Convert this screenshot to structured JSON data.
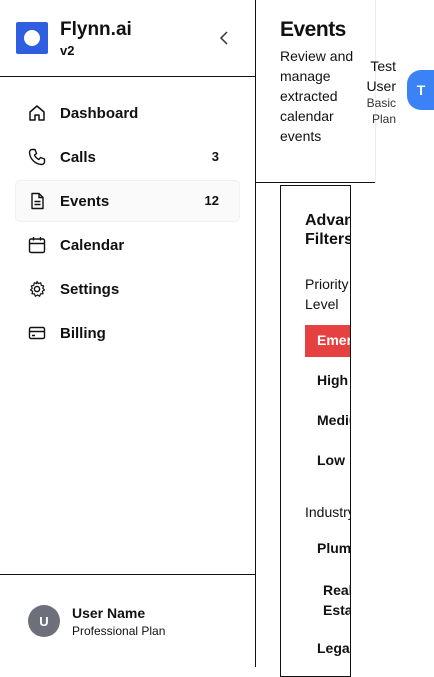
{
  "brand": {
    "name": "Flynn.ai",
    "version": "v2"
  },
  "nav": [
    {
      "label": "Dashboard",
      "count": "",
      "icon": "home-icon"
    },
    {
      "label": "Calls",
      "count": "3",
      "icon": "phone-icon"
    },
    {
      "label": "Events",
      "count": "12",
      "icon": "document-icon",
      "active": true
    },
    {
      "label": "Calendar",
      "count": "",
      "icon": "calendar-icon"
    },
    {
      "label": "Settings",
      "count": "",
      "icon": "gear-icon"
    },
    {
      "label": "Billing",
      "count": "",
      "icon": "credit-card-icon"
    }
  ],
  "sidebar_user": {
    "initial": "U",
    "name": "User Name",
    "plan": "Professional Plan"
  },
  "header": {
    "title": "Events",
    "description": "Review and manage extracted calendar events"
  },
  "account": {
    "name": "Test User",
    "plan": "Basic Plan",
    "initial": "T"
  },
  "filters": {
    "title_line1": "Advanced",
    "title_line2": "Filters",
    "priority_label": "Priority Level",
    "priority_options": [
      "Emergency",
      "High",
      "Medium",
      "Low"
    ],
    "selected_priority": "Emergency",
    "industry_label": "Industry",
    "industry_options": [
      "Plumbing",
      "Real Estate",
      "Legal"
    ]
  },
  "colors": {
    "brand": "#2f5ee0",
    "accent_blue": "#3b82f6",
    "emergency": "#e54141"
  }
}
